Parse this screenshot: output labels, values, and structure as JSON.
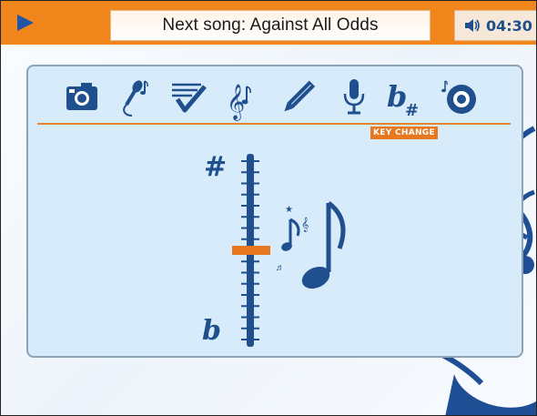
{
  "header": {
    "song_label": "Next song: Against All Odds",
    "time": "04:30",
    "play_icon": "play-icon",
    "volume_icon": "speaker-icon"
  },
  "toolbar": {
    "items": [
      {
        "icon": "camera-icon"
      },
      {
        "icon": "microphone-notes-icon"
      },
      {
        "icon": "checklist-icon"
      },
      {
        "icon": "treble-clef-notes-icon"
      },
      {
        "icon": "pencil-icon"
      },
      {
        "icon": "microphone-icon"
      },
      {
        "icon": "flat-sharp-icon"
      },
      {
        "icon": "cd-disc-icon"
      }
    ],
    "active_label": "KEY CHANGE"
  },
  "key_change": {
    "sharp_symbol": "#",
    "flat_symbol": "b",
    "level": 0.5
  },
  "colors": {
    "orange": "#f1861d",
    "blue": "#1f4f8c",
    "panel": "#d7ebfa"
  }
}
